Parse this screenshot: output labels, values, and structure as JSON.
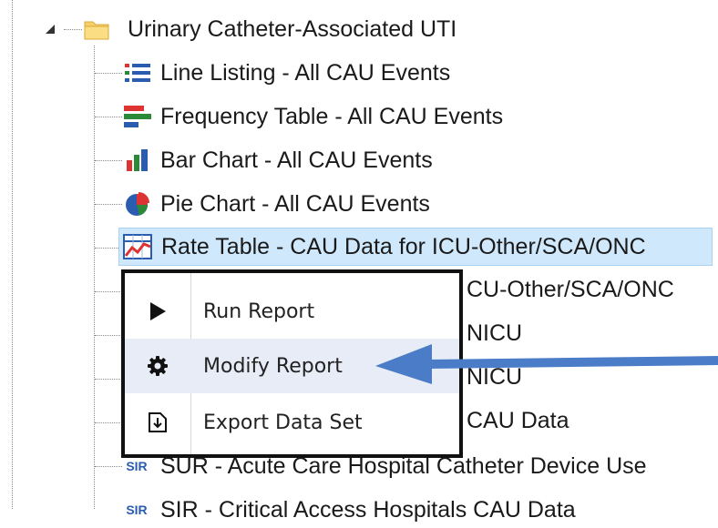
{
  "tree": {
    "folder_label": "Urinary Catheter-Associated UTI",
    "items": [
      {
        "label": "Line Listing - All CAU Events",
        "icon": "line-listing-icon"
      },
      {
        "label": "Frequency Table - All CAU Events",
        "icon": "frequency-table-icon"
      },
      {
        "label": "Bar Chart - All CAU Events",
        "icon": "bar-chart-icon"
      },
      {
        "label": "Pie Chart - All CAU Events",
        "icon": "pie-chart-icon"
      },
      {
        "label": "Rate Table - CAU Data for ICU-Other/SCA/ONC",
        "icon": "rate-table-icon"
      }
    ],
    "obscured_fragments": [
      "CU-Other/SCA/ONC",
      "NICU",
      "NICU",
      "CAU Data"
    ],
    "partial_items": [
      {
        "label": "SUR - Acute Care Hospital Catheter Device Use",
        "icon_text": "SIR"
      },
      {
        "label": "SIR - Critical Access Hospitals CAU Data",
        "icon_text": "SIR"
      }
    ]
  },
  "context_menu": {
    "items": [
      {
        "label": "Run Report",
        "icon": "play-icon"
      },
      {
        "label": "Modify Report",
        "icon": "gear-icon"
      },
      {
        "label": "Export Data Set",
        "icon": "export-icon"
      }
    ]
  },
  "colors": {
    "selection_bg": "#cfe8fb",
    "menu_border": "#111111",
    "arrow": "#4a7cc7"
  }
}
